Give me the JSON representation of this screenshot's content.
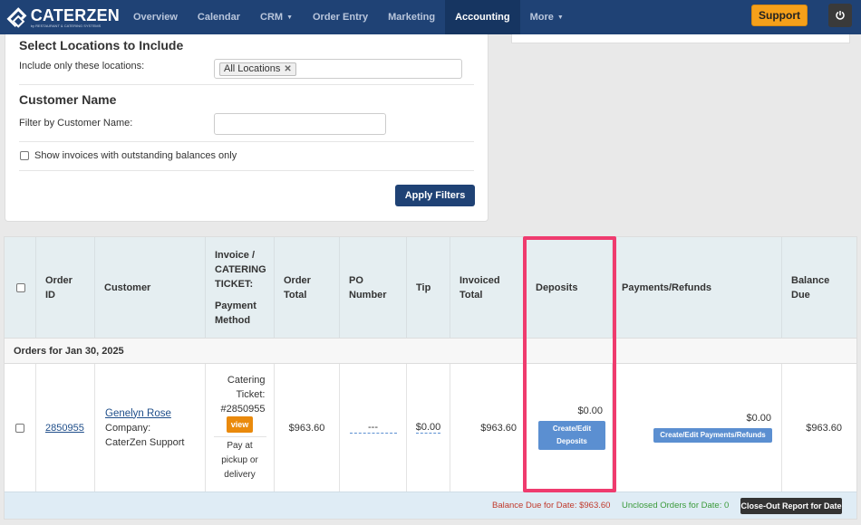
{
  "brand": {
    "name": "CATERZEN",
    "subtitle": "by RESTAURANT & CATERING SYSTEMS"
  },
  "nav": {
    "items": [
      {
        "label": "Overview",
        "caret": false,
        "active": false
      },
      {
        "label": "Calendar",
        "caret": false,
        "active": false
      },
      {
        "label": "CRM",
        "caret": true,
        "active": false
      },
      {
        "label": "Order Entry",
        "caret": false,
        "active": false
      },
      {
        "label": "Marketing",
        "caret": false,
        "active": false
      },
      {
        "label": "Accounting",
        "caret": false,
        "active": true
      },
      {
        "label": "More",
        "caret": true,
        "active": false
      }
    ],
    "support_label": "Support",
    "power_icon": "power-icon"
  },
  "filters": {
    "locations_title": "Select Locations to Include",
    "locations_label": "Include only these locations:",
    "locations_tag": "All Locations",
    "customer_title": "Customer Name",
    "customer_label": "Filter by Customer Name:",
    "customer_value": "",
    "outstanding_label": "Show invoices with outstanding balances only",
    "outstanding_checked": false,
    "apply_label": "Apply Filters"
  },
  "table": {
    "headers": {
      "order_id": "Order ID",
      "customer": "Customer",
      "invoice_l1": "Invoice / CATERING TICKET:",
      "invoice_l2": "Payment Method",
      "order_total": "Order Total",
      "po_number": "PO Number",
      "tip": "Tip",
      "invoiced_total": "Invoiced Total",
      "deposits": "Deposits",
      "payments": "Payments/Refunds",
      "balance_due": "Balance Due"
    },
    "group_label": "Orders for Jan 30, 2025",
    "row": {
      "order_id": "2850955",
      "customer_name": "Genelyn Rose",
      "company": "Company: CaterZen Support",
      "ticket": "Catering Ticket: #2850955",
      "view_label": "view",
      "payment_method": "Pay at pickup or delivery",
      "order_total": "$963.60",
      "po_number": "---",
      "tip": "$0.00",
      "invoiced_total": "$963.60",
      "deposits_amount": "$0.00",
      "deposits_button": "Create/Edit Deposits",
      "payments_amount": "$0.00",
      "payments_button": "Create/Edit Payments/Refunds",
      "balance_due": "$963.60"
    },
    "footer": {
      "balance_text": "Balance Due for Date: $963.60",
      "unclosed_text": "Unclosed Orders for Date: 0",
      "closeout_label": "Close-Out Report for Date"
    }
  },
  "colors": {
    "nav_bg": "#1f4275",
    "accent_orange": "#f5a01a",
    "highlight_pink": "#ef3b6e",
    "button_blue": "#5b8fd1",
    "balance_red": "#c0392b",
    "unclosed_green": "#3a9a3a"
  }
}
